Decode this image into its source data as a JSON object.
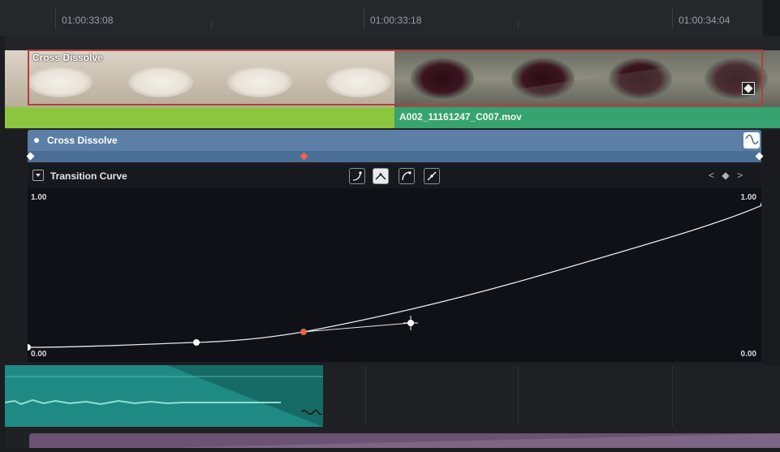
{
  "ruler": {
    "timecodes": [
      "01:00:33:08",
      "01:00:33:18",
      "01:00:34:04"
    ]
  },
  "video_track": {
    "transition_label": "Cross Dissolve",
    "clip_b_name": "A002_11161247_C007.mov"
  },
  "dissolve_header": {
    "title": "Cross Dissolve"
  },
  "curve_editor": {
    "title": "Transition Curve",
    "y_top_left": "1.00",
    "y_top_right": "1.00",
    "y_bottom_left": "0.00",
    "y_bottom_right": "0.00",
    "toolbar_buttons": [
      "ease-in-icon",
      "ease-both-icon",
      "ease-out-icon",
      "linear-icon"
    ],
    "active_button": "ease-both-icon",
    "keyframe_nav": "< ◆ >"
  },
  "colors": {
    "clip_a_bar": "#8cc63e",
    "clip_b_bar": "#37a36f",
    "transition_header": "#5b7fa6",
    "selected_keyframe": "#e8654f",
    "audio_clip": "#1f8a83",
    "purple_clip": "#6c5273"
  }
}
